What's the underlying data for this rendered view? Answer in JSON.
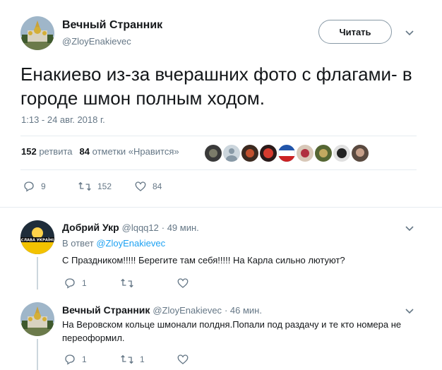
{
  "main_tweet": {
    "author_name": "Вечный Странник",
    "author_handle": "@ZloyEnakievec",
    "follow_label": "Читать",
    "text": "Енакиево из-за вчерашних фото с флагами- в городе шмон полным ходом.",
    "timestamp": "1:13 - 24 авг. 2018 г.",
    "retweets_count": "152",
    "retweets_label": "ретвита",
    "likes_count": "84",
    "likes_label": "отметки «Нравится»",
    "actions": {
      "replies": "9",
      "retweets": "152",
      "likes": "84"
    }
  },
  "replies": [
    {
      "author_name": "Добрий Укр",
      "author_handle": "@lqqq12",
      "time": "· 49 мин.",
      "in_reply_prefix": "В ответ",
      "in_reply_handle": "@ZloyEnakievec",
      "avatar_text": "СЛАВА УКРАЇНІ",
      "text": "С Праздником!!!!! Берегите там себя!!!!! На Карла сильно лютуют?",
      "actions": {
        "replies": "1",
        "retweets": "",
        "likes": ""
      }
    },
    {
      "author_name": "Вечный Странник",
      "author_handle": "@ZloyEnakievec",
      "time": "· 46 мин.",
      "text": "На Веровском кольце шмонали полдня.Попали под раздачу и те кто номера не переоформил.",
      "actions": {
        "replies": "1",
        "retweets": "1",
        "likes": ""
      }
    }
  ],
  "colors": {
    "text": "#14171a",
    "secondary": "#657786",
    "link": "#1da1f2",
    "border": "#e6ecf0"
  }
}
